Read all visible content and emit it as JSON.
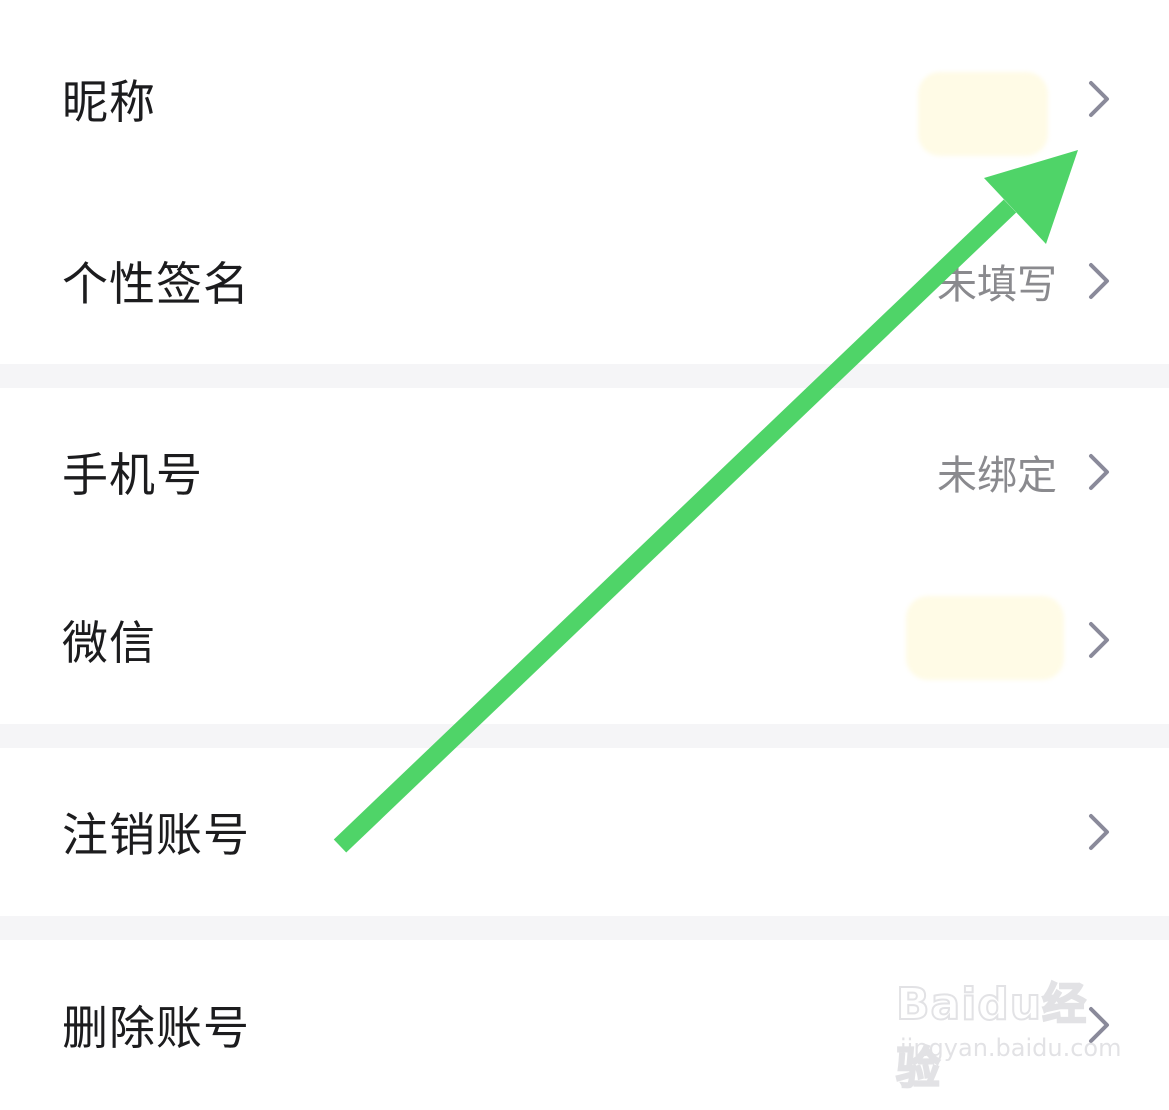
{
  "rows": [
    {
      "label": "昵称",
      "value": ""
    },
    {
      "label": "个性签名",
      "value": "未填写"
    },
    {
      "label": "手机号",
      "value": "未绑定"
    },
    {
      "label": "微信",
      "value": ""
    },
    {
      "label": "注销账号",
      "value": ""
    },
    {
      "label": "删除账号",
      "value": ""
    }
  ],
  "watermark": {
    "logo_text": "Baidu经验",
    "url_text": "jingyan.baidu.com"
  },
  "icons": {
    "chevron": "chevron-right-icon",
    "arrow": "annotation-arrow-icon"
  },
  "colors": {
    "arrow": "#4fd468",
    "chevron": "#8a8a9a",
    "separator": "#f5f5f7"
  }
}
